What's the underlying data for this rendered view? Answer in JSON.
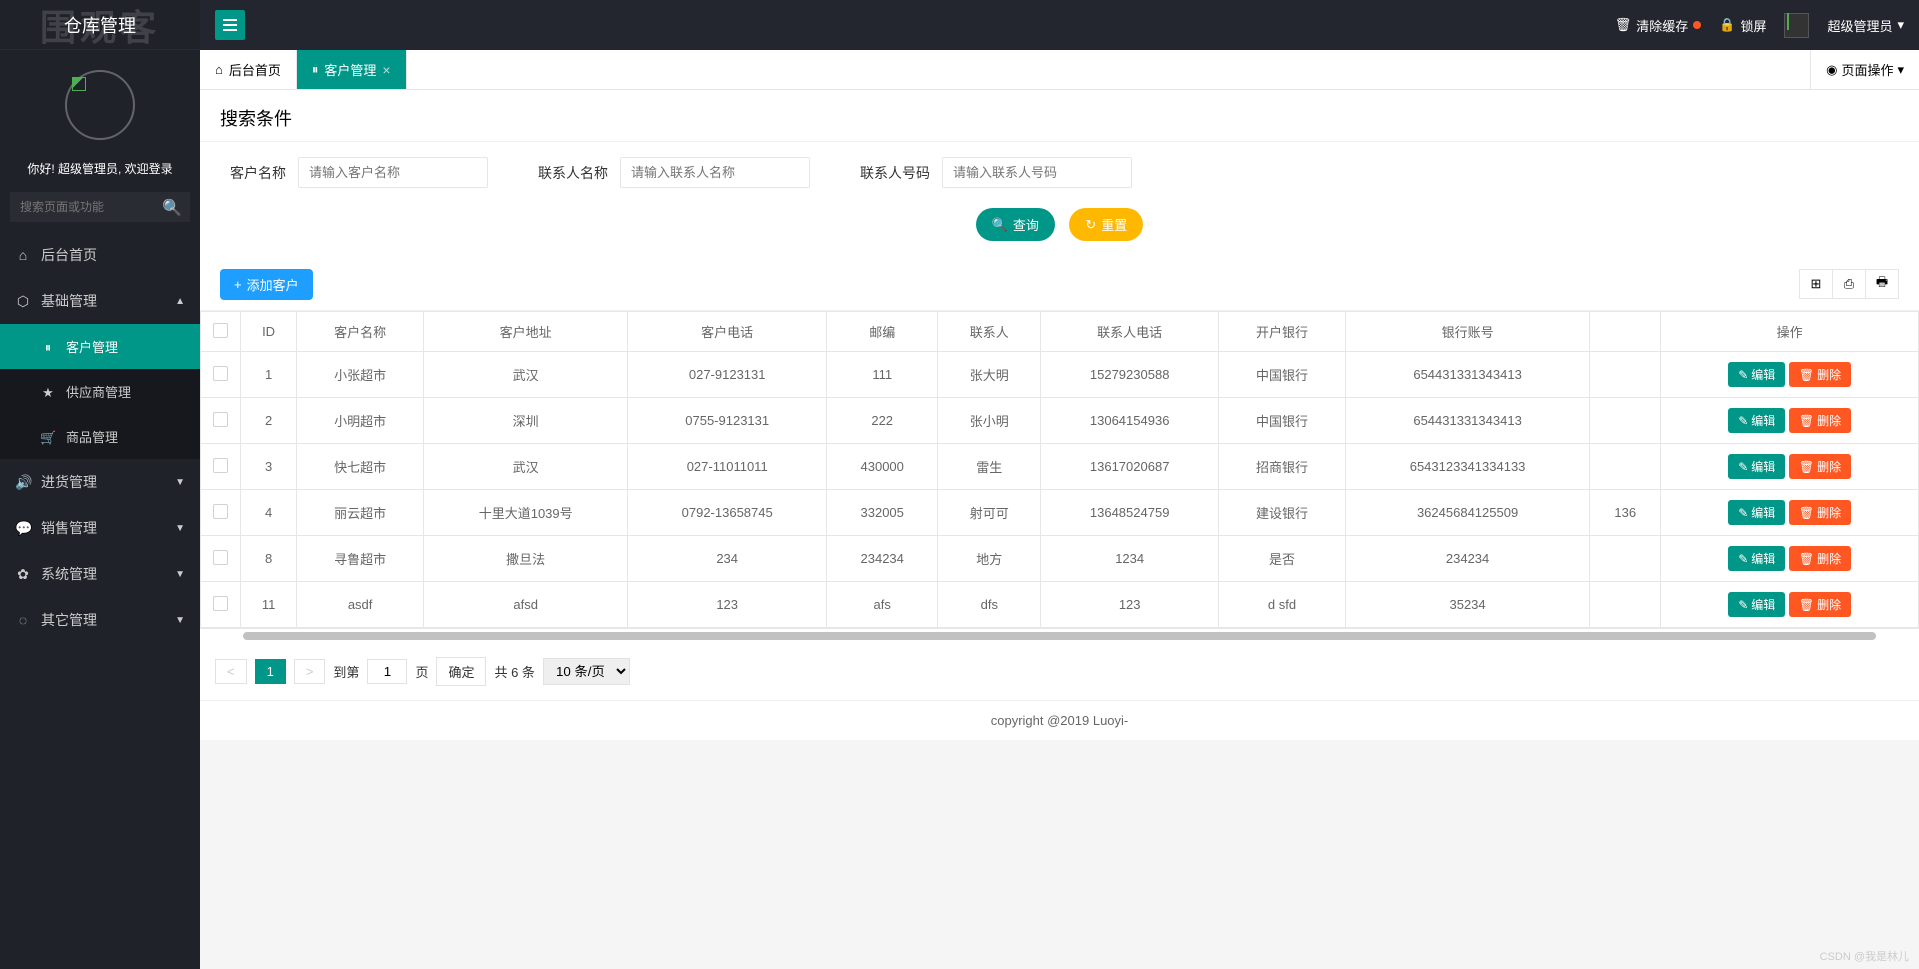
{
  "logo": "仓库管理",
  "watermark_logo": "围观客",
  "welcome": "你好! 超级管理员, 欢迎登录",
  "search_placeholder": "搜索页面或功能",
  "sidebar": {
    "items": [
      {
        "icon": "⌂",
        "label": "后台首页"
      },
      {
        "icon": "⬡",
        "label": "基础管理",
        "expanded": true,
        "children": [
          {
            "icon": "⏸",
            "label": "客户管理",
            "active": true
          },
          {
            "icon": "★",
            "label": "供应商管理"
          },
          {
            "icon": "🛒",
            "label": "商品管理"
          }
        ]
      },
      {
        "icon": "🔊",
        "label": "进货管理"
      },
      {
        "icon": "💬",
        "label": "销售管理"
      },
      {
        "icon": "✿",
        "label": "系统管理"
      },
      {
        "icon": "◌",
        "label": "其它管理"
      }
    ]
  },
  "topbar": {
    "clear_cache": "清除缓存",
    "lock": "锁屏",
    "username": "超级管理员"
  },
  "tabs": [
    {
      "icon": "⌂",
      "label": "后台首页",
      "closable": false,
      "active": false
    },
    {
      "icon": "⏸",
      "label": "客户管理",
      "closable": true,
      "active": true
    }
  ],
  "page_ops": "页面操作",
  "search_panel": {
    "title": "搜索条件",
    "fields": [
      {
        "label": "客户名称",
        "placeholder": "请输入客户名称"
      },
      {
        "label": "联系人名称",
        "placeholder": "请输入联系人名称"
      },
      {
        "label": "联系人号码",
        "placeholder": "请输入联系人号码"
      }
    ],
    "query_btn": "查询",
    "reset_btn": "重置"
  },
  "toolbar": {
    "add_btn": "添加客户"
  },
  "table": {
    "headers": [
      "",
      "ID",
      "客户名称",
      "客户地址",
      "客户电话",
      "邮编",
      "联系人",
      "联系人电话",
      "开户银行",
      "银行账号",
      "",
      "操作"
    ],
    "edit": "编辑",
    "del": "删除",
    "rows": [
      {
        "id": "1",
        "name": "小张超市",
        "addr": "武汉",
        "tel": "027-9123131",
        "zip": "111",
        "contact": "张大明",
        "ctel": "15279230588",
        "bank": "中国银行",
        "acct": "654431331343413",
        "ext": ""
      },
      {
        "id": "2",
        "name": "小明超市",
        "addr": "深圳",
        "tel": "0755-9123131",
        "zip": "222",
        "contact": "张小明",
        "ctel": "13064154936",
        "bank": "中国银行",
        "acct": "654431331343413",
        "ext": ""
      },
      {
        "id": "3",
        "name": "快七超市",
        "addr": "武汉",
        "tel": "027-11011011",
        "zip": "430000",
        "contact": "雷生",
        "ctel": "13617020687",
        "bank": "招商银行",
        "acct": "6543123341334133",
        "ext": ""
      },
      {
        "id": "4",
        "name": "丽云超市",
        "addr": "十里大道1039号",
        "tel": "0792-13658745",
        "zip": "332005",
        "contact": "射可可",
        "ctel": "13648524759",
        "bank": "建设银行",
        "acct": "36245684125509",
        "ext": "136"
      },
      {
        "id": "8",
        "name": "寻鲁超市",
        "addr": "撒旦法",
        "tel": "234",
        "zip": "234234",
        "contact": "地方",
        "ctel": "1234",
        "bank": "是否",
        "acct": "234234",
        "ext": ""
      },
      {
        "id": "11",
        "name": "asdf",
        "addr": "afsd",
        "tel": "123",
        "zip": "afs",
        "contact": "dfs",
        "ctel": "123",
        "bank": "d sfd",
        "acct": "35234",
        "ext": ""
      }
    ]
  },
  "pager": {
    "goto": "到第",
    "page_unit": "页",
    "confirm": "确定",
    "total": "共 6 条",
    "per_page": "10 条/页",
    "current": "1",
    "input": "1"
  },
  "footer": "copyright @2019 Luoyi-",
  "bottom_watermark": "CSDN @我是林儿"
}
